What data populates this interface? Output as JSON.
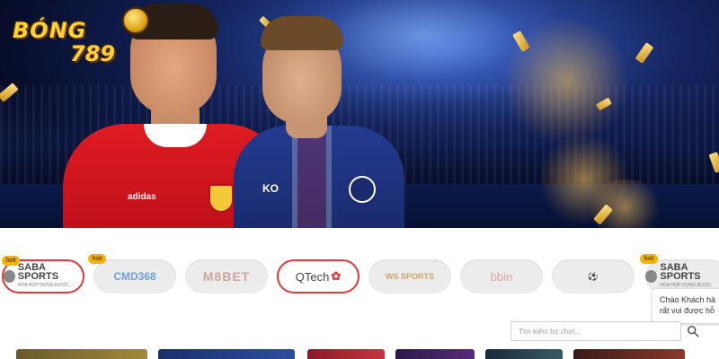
{
  "brand": {
    "line1": "BÓNG",
    "line2": "789"
  },
  "hero": {
    "player1_shirt_sponsor": "adidas",
    "player2_shirt_text": "KO"
  },
  "providers": [
    {
      "name": "SABA SPORTS",
      "sub": "HÒA HỢP DỰNG ĐƯỢC",
      "hot": true,
      "active": true
    },
    {
      "name": "CMD368",
      "hot": true,
      "active": false
    },
    {
      "name": "M8BET",
      "hot": false,
      "active": false
    },
    {
      "name": "QTech",
      "hot": false,
      "active": true
    },
    {
      "name": "WS SPORTS",
      "hot": false,
      "active": false
    },
    {
      "name": "bbin",
      "hot": false,
      "active": false
    },
    {
      "name": "",
      "hot": false,
      "active": false
    },
    {
      "name": "SABA SPORTS",
      "sub": "HÒA HỢP DỰNG ĐƯỢC",
      "hot": true,
      "active": false
    }
  ],
  "hot_label": "hot",
  "search": {
    "placeholder": "Tìm kiếm trò chơi...",
    "value": ""
  },
  "chat": {
    "line1": "Chào Khách hà",
    "line2": "rất vui được hỗ"
  },
  "colors": {
    "accent": "#e0393e",
    "hot_badge": "#f5b400",
    "brand_gold": "#ffd233"
  },
  "icons": {
    "search": "search-icon",
    "brand_ball": "soccer-ball-icon"
  }
}
